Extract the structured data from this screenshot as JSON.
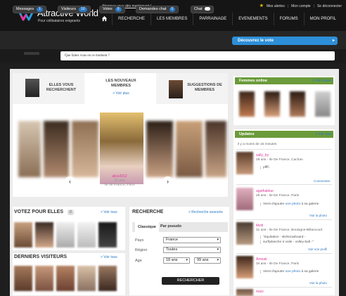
{
  "brand": {
    "name": "Attractive World",
    "tagline": "Pour célibataires exigeants",
    "accent": "#e0389a",
    "blue": "#2b78c4"
  },
  "header": {
    "promo": "Abonnez vous dès maintenant !",
    "alerts": "Mes alertes",
    "account": "Mon compte",
    "logout": "Se déconnecter"
  },
  "nav": [
    "RECHERCHE",
    "LES MEMBRES",
    "PARRAINAGE",
    "EVENEMENTS",
    "FORUMS",
    "MON PROFIL"
  ],
  "subnav": {
    "messages": "Messages",
    "messages_count": "1",
    "visitors": "Visiteurs",
    "visitors_count": "10",
    "votes": "Votes",
    "votes_count": "0",
    "chat_requests": "Demandes chat",
    "chat_requests_count": "0",
    "chat": "Chat",
    "discover": "Découvrez le vote"
  },
  "status": {
    "placeholder": "Que faites vous en ce moment ?"
  },
  "tabs": {
    "they_search": "ELLES VOUS RECHERCHENT",
    "new_members": "LES NOUVEAUX MEMBRES",
    "see_more": "> Voir plus",
    "suggestions": "SUGGESTIONS DE MEMBRES"
  },
  "featured": {
    "name": "alice2012",
    "age": "23 ans",
    "location": "Ile de France, Paris"
  },
  "vote_section": {
    "title": "VOTEZ POUR ELLES",
    "count": "0",
    "link": "> Voir tous"
  },
  "visitors_section": {
    "title": "DERNIERS VISITEURS",
    "link": "> Voir tous"
  },
  "search": {
    "title": "RECHERCHE",
    "advanced": "> Recherche avancée",
    "tab_classic": "Classique",
    "tab_pseudo": "Par pseudo",
    "country_label": "Pays",
    "country_value": "France",
    "region_label": "Région",
    "region_value": "Toutes",
    "age_label": "Age",
    "age_min": "18 ans",
    "age_max": "99 ans",
    "button": "RECHERCHER"
  },
  "online": {
    "title": "Femmes online",
    "link": "> Voir toutes"
  },
  "updates": {
    "title": "Updates",
    "link": "> Voir tous",
    "since": "il y a moins de 15 minutes",
    "items": [
      {
        "name": "sally_by",
        "meta": "28 ans - Ile De France, Cachan",
        "body": "pffff..",
        "link": "",
        "action": "Commenter"
      },
      {
        "name": "agathablue",
        "meta": "26 ans - Ile De France, Paris",
        "body": "Vient d'ajouter ",
        "link": "une photo",
        "tail": " à sa galerie",
        "action": "Voir la photo"
      },
      {
        "name": "tikoti",
        "meta": "31 ans - Ile De France, Boulogne-Billancourt",
        "body": "\"équitation - ski/snowboard -",
        "body2": "surf/planche à voile - volley-ball -\"",
        "link": "",
        "action": "Voir son profil"
      },
      {
        "name": "Amoati",
        "meta": "34 ans - Ile De France, Paris",
        "body": "Vient d'ajouter ",
        "link": "une photo",
        "tail": " à sa galerie",
        "action": "Voir la photo"
      },
      {
        "name": "maxi",
        "meta": "",
        "body": "",
        "link": "",
        "action": ""
      }
    ]
  }
}
